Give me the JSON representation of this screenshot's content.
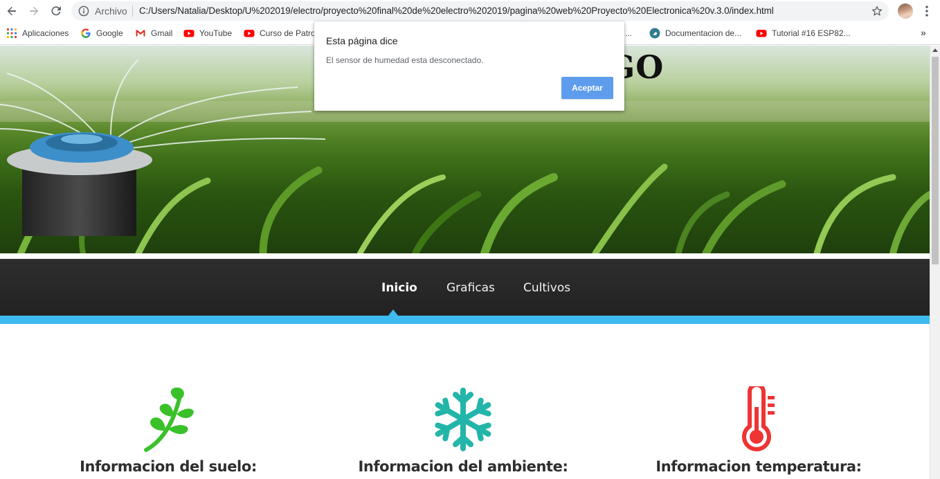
{
  "browser": {
    "scheme_label": "Archivo",
    "url": "C:/Users/Natalia/Desktop/U%202019/electro/proyecto%20final%20de%20electro%202019/pagina%20web%20Proyecto%20Electronica%20v.3.0/index.html",
    "icons": {
      "back": "arrow-left-icon",
      "forward": "arrow-right-icon",
      "reload": "reload-icon",
      "info": "info-icon",
      "bookmark_star": "star-icon",
      "menu": "kebab-menu-icon"
    }
  },
  "bookmarks": [
    {
      "label": "Aplicaciones",
      "icon": "apps-grid-icon"
    },
    {
      "label": "Google",
      "icon": "google-icon"
    },
    {
      "label": "Gmail",
      "icon": "gmail-icon"
    },
    {
      "label": "YouTube",
      "icon": "youtube-icon"
    },
    {
      "label": "Curso de Patro",
      "icon": "youtube-icon"
    },
    {
      "label": "...",
      "icon": ""
    },
    {
      "label": "Documentacion de...",
      "icon": "globe-icon"
    },
    {
      "label": "Tutorial #16 ESP82...",
      "icon": "youtube-icon"
    }
  ],
  "bookmarks_more": "»",
  "page": {
    "hero_title_fragment": "GO",
    "nav": {
      "items": [
        "Inicio",
        "Graficas",
        "Cultivos"
      ],
      "active": "Inicio",
      "accent_color": "#3dbbee"
    },
    "features": [
      {
        "title": "Informacion del suelo:",
        "icon": "leaf-branch-icon",
        "color": "#3ac12a"
      },
      {
        "title": "Informacion del ambiente:",
        "icon": "snowflake-icon",
        "color": "#23b5a9"
      },
      {
        "title": "Informacion temperatura:",
        "icon": "thermometer-icon",
        "color": "#ee3434"
      }
    ]
  },
  "dialog": {
    "title": "Esta página dice",
    "message": "El sensor de humedad esta desconectado.",
    "ok_label": "Aceptar"
  }
}
